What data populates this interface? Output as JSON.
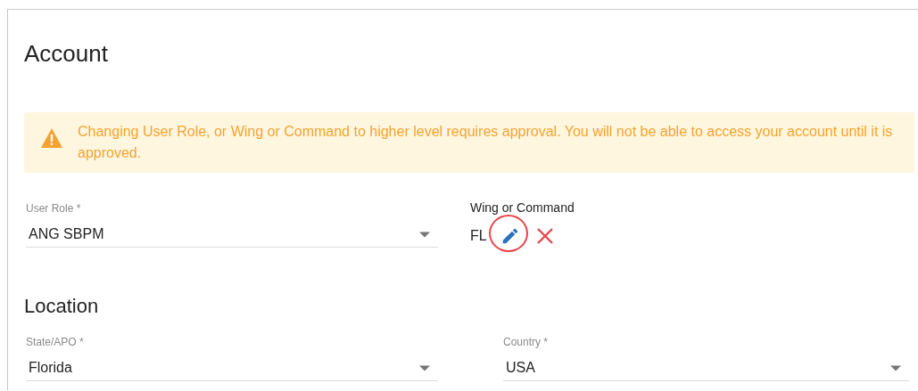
{
  "title": "Account",
  "alert": {
    "text": "Changing User Role, or Wing or Command to higher level requires approval. You will not be able to access your account until it is approved."
  },
  "user_role": {
    "label": "User Role *",
    "value": "ANG SBPM"
  },
  "wing_or_command": {
    "label": "Wing or Command",
    "value": "FL",
    "edit_highlighted": true
  },
  "location": {
    "heading": "Location",
    "fields": [
      {
        "label": "State/APO *",
        "value": "Florida"
      },
      {
        "label": "Country *",
        "value": "USA"
      }
    ]
  }
}
